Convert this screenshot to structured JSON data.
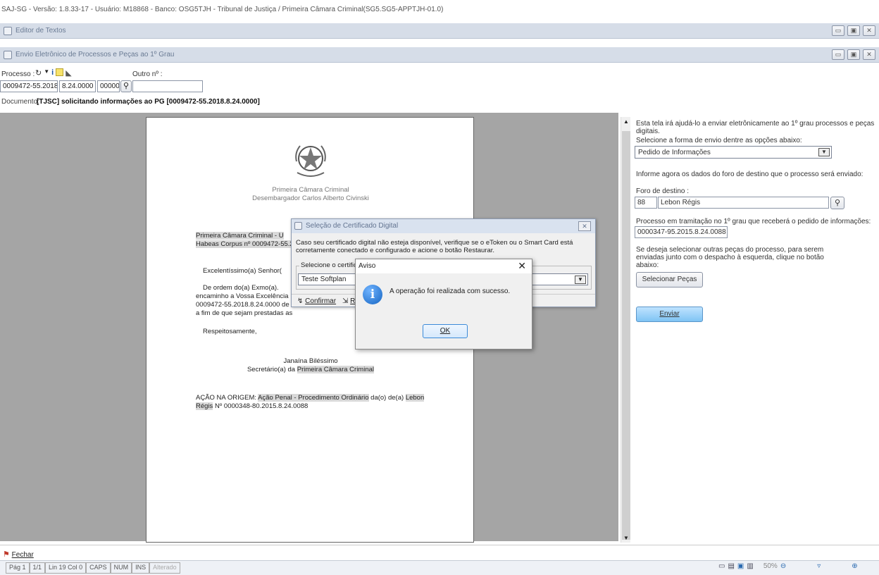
{
  "app_title": "SAJ-SG - Versão: 1.8.33-17 - Usuário: M18868 - Banco: OSG5TJH - Tribunal de Justiça / Primeira Câmara Criminal(SG5.SG5-APPTJH-01.0)",
  "windows": {
    "editor_title": "Editor de Textos",
    "envio_title": "Envio Eletrônico de Processos e Peças ao 1º Grau"
  },
  "form": {
    "processo_label": "Processo :",
    "outro_label": "Outro nº :",
    "proc_part1": "0009472-55.2018",
    "proc_part2": "8.24.0000",
    "proc_part3": "00000",
    "outro_value": "",
    "documento_label": "Documento:",
    "documento_value": "[TJSC] solicitando informações ao PG [0009472-55.2018.8.24.0000]"
  },
  "document": {
    "header1": "Primeira Câmara Criminal",
    "header2": "Desembargador Carlos Alberto Civinski",
    "line1": "Primeira Câmara Criminal - U",
    "line2": "Habeas Corpus nº 0009472-55.2",
    "salutation": "Excelentíssimo(a) Senhor(",
    "body1": "De ordem do(a) Exmo(a).",
    "body2": "encaminho a Vossa Excelência",
    "body3": "0009472-55.2018.8.24.0000 de L",
    "body4": "a fim de que sejam prestadas as",
    "closing": "Respeitosamente,",
    "signer": "Janaína Biléssimo",
    "signer_role_prefix": "Secretário(a) da",
    "signer_role_hl": "Primeira Câmara Criminal",
    "origin_prefix": "AÇÃO NA ORIGEM:",
    "origin_hl": "Ação Penal - Procedimento Ordinário",
    "origin_mid": "da(o) de(a)",
    "origin_place": "Lebon",
    "origin_place2": "Régis",
    "origin_num": "Nº 0000348-80.2015.8.24.0088"
  },
  "right_panel": {
    "intro": "Esta tela irá ajudá-lo a enviar eletrônicamente ao 1º grau processos e peças digitais.",
    "select_label": "Selecione a forma de envio dentre as opções abaixo:",
    "select_value": "Pedido de Informações",
    "info_label": "Informe agora os dados do foro de destino que o processo será enviado:",
    "foro_label": "Foro de destino :",
    "foro_code": "88",
    "foro_name": "Lebon Régis",
    "processo_label": "Processo em tramitação no 1º grau que receberá o pedido de informações:",
    "processo_value": "0000347-95.2015.8.24.0088",
    "pecas_text": "Se deseja selecionar outras peças do processo, para serem enviadas junto com o despacho à esquerda, clique no botão abaixo:",
    "selecionar_btn": "Selecionar Peças",
    "enviar_btn": "Enviar"
  },
  "cert_dialog": {
    "title": "Seleção de Certificado Digital",
    "message": "Caso seu certificado digital não esteja disponível, verifique se o eToken ou o Smart Card está corretamente conectado e configurado e acione o botão Restaurar.",
    "group_label": "Selecione o certific",
    "select_value": "Teste Softplan",
    "confirm_btn": "Confirmar",
    "other_btn": "R"
  },
  "aviso_dialog": {
    "title": "Aviso",
    "message": "A operação foi realizada com sucesso.",
    "ok_btn": "OK"
  },
  "footer": {
    "fechar": "Fechar"
  },
  "statusbar": {
    "page": "Pág 1",
    "pages": "1/1",
    "line": "Lin 19 Col 0",
    "caps": "CAPS",
    "num": "NUM",
    "ins": "INS",
    "mod": "Alterado",
    "zoom": "50%"
  },
  "colors": {
    "window_bar": "#d6dde8",
    "doc_background": "#a5a5a5",
    "enviar_button": "#7fc4f4",
    "highlight": "#d9d9d9"
  }
}
